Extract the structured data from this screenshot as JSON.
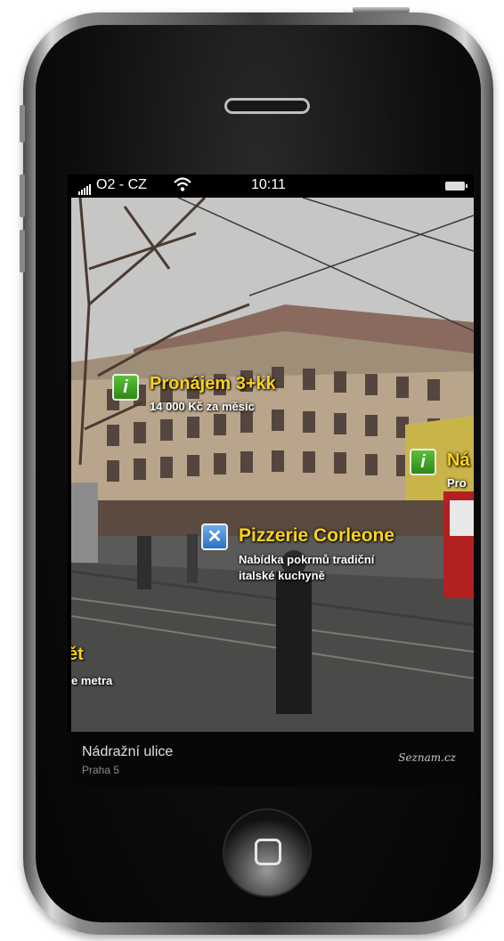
{
  "status_bar": {
    "carrier": "O2 - CZ",
    "time": "10:11"
  },
  "ar_labels": [
    {
      "icon": "info-icon",
      "title": "Pronájem 3+kk",
      "subtitle": "14 000 Kč za měsíc"
    },
    {
      "icon": "info-icon",
      "title": "Ná",
      "subtitle": "Pro"
    },
    {
      "icon": "restaurant-icon",
      "title": "Pizzerie Corleone",
      "subtitle_lines": [
        "Nabídka pokrmů tradiční",
        "italské kuchyně"
      ]
    },
    {
      "icon": "",
      "title": "ět",
      "subtitle": "e metra"
    }
  ],
  "info_bar": {
    "street": "Nádražní ulice",
    "district": "Praha 5",
    "brand": "Seznam.cz"
  },
  "colors": {
    "label_title": "#ffd21a",
    "info_icon": "#3ea324",
    "restaurant_icon": "#3a86d8"
  }
}
